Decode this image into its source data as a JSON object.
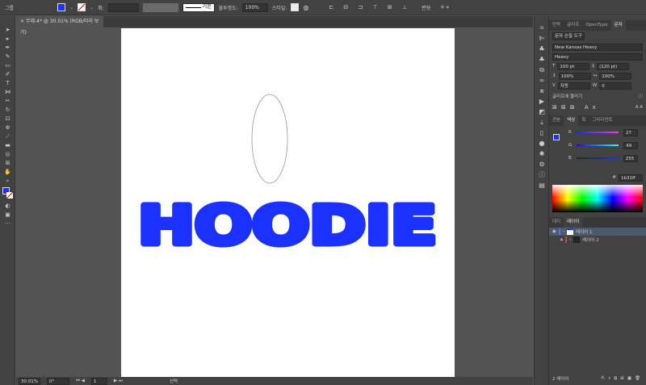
{
  "control_bar": {
    "selection_label": "그룹",
    "stroke_label": "획:",
    "stroke_style": "기본",
    "opacity_label": "불투명도:",
    "opacity_value": "100%",
    "style_label": "스타일:",
    "transform_label": "변형"
  },
  "document_tab": {
    "title": "무제-4* @ 30.01% (RGB/미리 보기)"
  },
  "artwork": {
    "text": "HOODIE",
    "fill_color": "#1b31ff"
  },
  "status_bar": {
    "zoom": "30.01%",
    "rotation": "0°",
    "artboard": "1",
    "mode": "선택"
  },
  "character_panel": {
    "tabs": [
      "단락",
      "글리프",
      "OpenType",
      "문자"
    ],
    "active_tab": "문자",
    "touch_tool": "문자 손질 도구",
    "font_family": "New Kansas Heavy",
    "font_style": "Heavy",
    "font_size": "100 pt",
    "leading": "(120 pt)",
    "vscale": "100%",
    "hscale": "100%",
    "kerning": "자동",
    "tracking": "0",
    "snap_label": "글리프에 물리기"
  },
  "color_panel": {
    "tabs": [
      "견본",
      "색상",
      "획",
      "그라디언트"
    ],
    "active_tab": "색상",
    "r_label": "R",
    "g_label": "G",
    "b_label": "B",
    "r": "27",
    "g": "49",
    "b": "255",
    "r_frac": 0.106,
    "g_frac": 0.192,
    "b_frac": 1.0,
    "hex": "1b31ff",
    "fill": "#1b31ff"
  },
  "layers_panel": {
    "tabs": [
      "대지",
      "레이어"
    ],
    "active_tab": "레이어",
    "layers": [
      {
        "name": "레이어 1",
        "color": "#4a7bd8"
      },
      {
        "name": "레이어 2",
        "color": "#d04040"
      }
    ],
    "count_label": "2 레이어"
  }
}
